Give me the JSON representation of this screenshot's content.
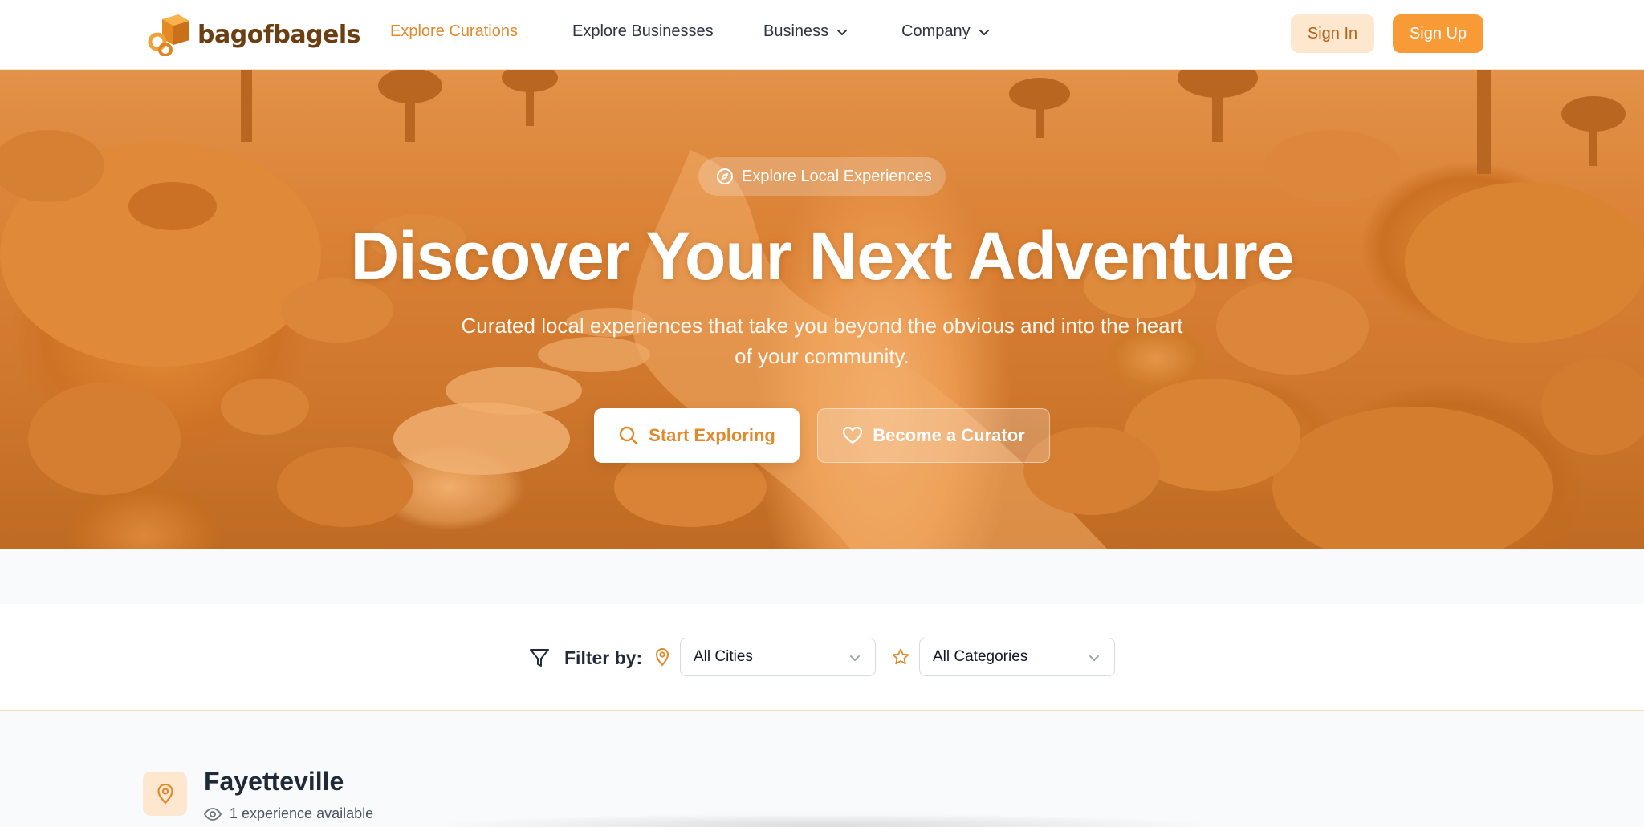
{
  "brand": {
    "name": "bagofbagels"
  },
  "nav": {
    "explore_curations": "Explore Curations",
    "explore_businesses": "Explore Businesses",
    "business": "Business",
    "company": "Company"
  },
  "auth": {
    "sign_in": "Sign In",
    "sign_up": "Sign Up"
  },
  "hero": {
    "pill": "Explore Local Experiences",
    "title": "Discover Your Next Adventure",
    "subtitle": "Curated local experiences that take you beyond the obvious and into the heart of your community.",
    "start_exploring": "Start Exploring",
    "become_curator": "Become a Curator"
  },
  "filter": {
    "label": "Filter by:",
    "city_selected": "All Cities",
    "category_selected": "All Categories"
  },
  "city_section": {
    "name": "Fayetteville",
    "count": "1 experience available"
  },
  "colors": {
    "accent": "#f89a35",
    "accent_text": "#e08a2c",
    "accent_soft": "#fde7cf"
  }
}
